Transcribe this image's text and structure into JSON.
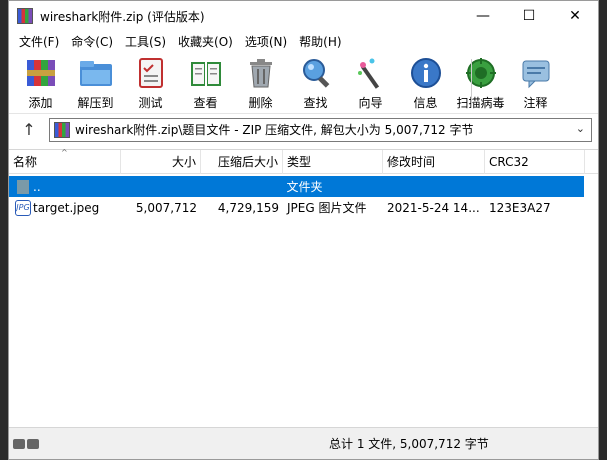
{
  "window": {
    "title": "wireshark附件.zip (评估版本)",
    "controls": {
      "minimize": "—",
      "maximize": "☐",
      "close": "✕"
    }
  },
  "menu": [
    "文件(F)",
    "命令(C)",
    "工具(S)",
    "收藏夹(O)",
    "选项(N)",
    "帮助(H)"
  ],
  "toolbar": [
    {
      "label": "添加",
      "icon": "add-archive-icon"
    },
    {
      "label": "解压到",
      "icon": "extract-folder-icon"
    },
    {
      "label": "测试",
      "icon": "test-checklist-icon"
    },
    {
      "label": "查看",
      "icon": "view-book-icon"
    },
    {
      "label": "删除",
      "icon": "trash-icon"
    },
    {
      "label": "查找",
      "icon": "magnifier-icon"
    },
    {
      "label": "向导",
      "icon": "wizard-wand-icon"
    },
    {
      "label": "信息",
      "icon": "info-icon"
    },
    {
      "label": "扫描病毒",
      "icon": "virus-scan-icon"
    },
    {
      "label": "注释",
      "icon": "comment-icon"
    }
  ],
  "address": {
    "path": "wireshark附件.zip\\题目文件 - ZIP 压缩文件, 解包大小为 5,007,712 字节"
  },
  "columns": [
    "名称",
    "大小",
    "压缩后大小",
    "类型",
    "修改时间",
    "CRC32"
  ],
  "rows": [
    {
      "name": "..",
      "size": "",
      "packed": "",
      "type": "文件夹",
      "modified": "",
      "crc": "",
      "selected": true
    },
    {
      "name": "target.jpeg",
      "size": "5,007,712",
      "packed": "4,729,159",
      "type": "JPEG 图片文件",
      "modified": "2021-5-24 14...",
      "crc": "123E3A27",
      "selected": false
    }
  ],
  "status": {
    "summary": "总计 1 文件, 5,007,712 字节"
  },
  "colors": {
    "selection": "#0078d7"
  }
}
